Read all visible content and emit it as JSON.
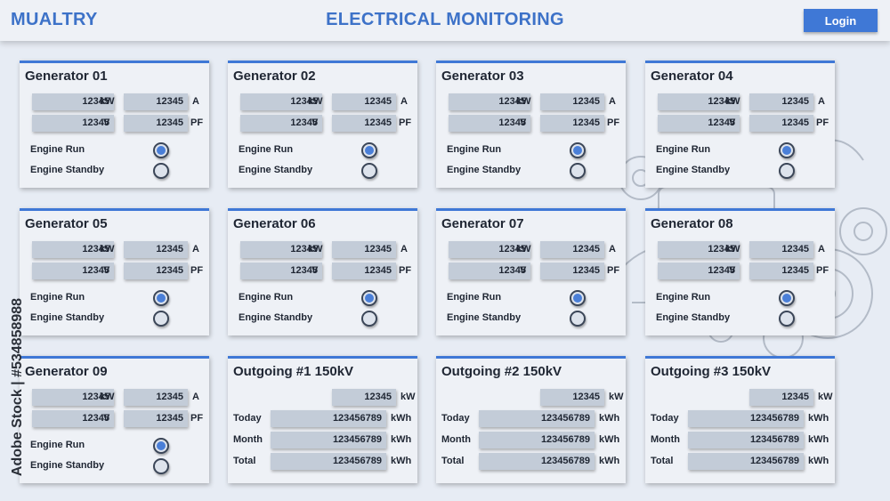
{
  "header": {
    "brand": "MUALTRY",
    "title": "ELECTRICAL MONITORING",
    "login_label": "Login"
  },
  "colors": {
    "accent": "#3f78d6",
    "panel": "#eef1f6",
    "field": "#c3ccd8",
    "background": "#e7ecf4"
  },
  "labels": {
    "engine_run": "Engine Run",
    "engine_standby": "Engine Standby",
    "today": "Today",
    "month": "Month",
    "total": "Total"
  },
  "units": {
    "kw": "kW",
    "a": "A",
    "v": "V",
    "pf": "PF",
    "kwh": "kWh"
  },
  "generators": [
    {
      "name": "Generator 01",
      "kw": "12345",
      "a": "12345",
      "v": "12345",
      "pf": "12345",
      "run": true,
      "standby": false
    },
    {
      "name": "Generator 02",
      "kw": "12345",
      "a": "12345",
      "v": "12345",
      "pf": "12345",
      "run": true,
      "standby": false
    },
    {
      "name": "Generator 03",
      "kw": "12345",
      "a": "12345",
      "v": "12345",
      "pf": "12345",
      "run": true,
      "standby": false
    },
    {
      "name": "Generator 04",
      "kw": "12345",
      "a": "12345",
      "v": "12345",
      "pf": "12345",
      "run": true,
      "standby": false
    },
    {
      "name": "Generator 05",
      "kw": "12345",
      "a": "12345",
      "v": "12345",
      "pf": "12345",
      "run": true,
      "standby": false
    },
    {
      "name": "Generator 06",
      "kw": "12345",
      "a": "12345",
      "v": "12345",
      "pf": "12345",
      "run": true,
      "standby": false
    },
    {
      "name": "Generator 07",
      "kw": "12345",
      "a": "12345",
      "v": "12345",
      "pf": "12345",
      "run": true,
      "standby": false
    },
    {
      "name": "Generator 08",
      "kw": "12345",
      "a": "12345",
      "v": "12345",
      "pf": "12345",
      "run": true,
      "standby": false
    },
    {
      "name": "Generator 09",
      "kw": "12345",
      "a": "12345",
      "v": "12345",
      "pf": "12345",
      "run": true,
      "standby": false
    }
  ],
  "outgoing": [
    {
      "name": "Outgoing #1 150kV",
      "kw": "12345",
      "today": "123456789",
      "month": "123456789",
      "total": "123456789"
    },
    {
      "name": "Outgoing #2 150kV",
      "kw": "12345",
      "today": "123456789",
      "month": "123456789",
      "total": "123456789"
    },
    {
      "name": "Outgoing #3 150kV",
      "kw": "12345",
      "today": "123456789",
      "month": "123456789",
      "total": "123456789"
    }
  ],
  "watermark": "Adobe Stock | #534858988",
  "icons": {
    "engine": "engine-illustration-icon",
    "radio_on": "radio-selected-icon",
    "radio_off": "radio-unselected-icon"
  }
}
